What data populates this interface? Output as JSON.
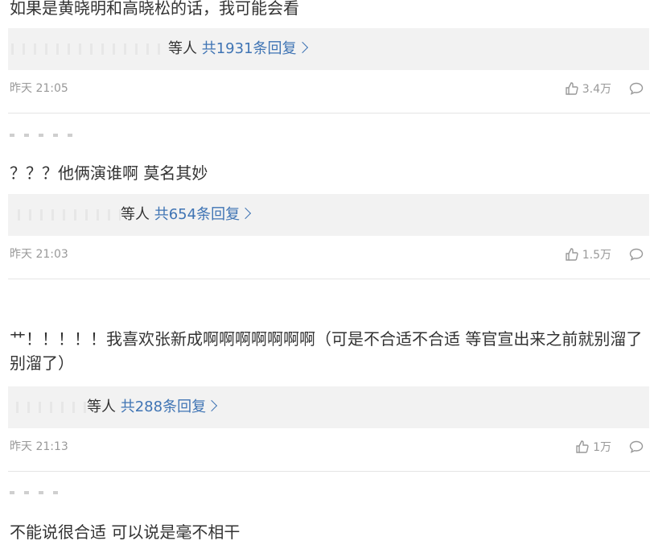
{
  "comments": [
    {
      "text": "如果是黄晓明和高晓松的话，我可能会看",
      "reply_names_suffix": "等人",
      "reply_link": "共1931条回复",
      "time": "昨天 21:05",
      "likes": "3.4万"
    },
    {
      "text": "？？？他俩演谁啊 莫名其妙",
      "reply_names_suffix": "等人",
      "reply_link": "共654条回复",
      "time": "昨天 21:03",
      "likes": "1.5万"
    },
    {
      "text": "艹！！！！！我喜欢张新成啊啊啊啊啊啊啊（可是不合适不合适 等官宣出来之前就别溜了别溜了）",
      "reply_names_suffix": "等人",
      "reply_link": "共288条回复",
      "time": "昨天 21:13",
      "likes": "1万"
    },
    {
      "text": "不能说很合适 可以说是毫不相干"
    }
  ],
  "icons": {
    "like": "thumbs-up-icon",
    "reply": "speech-bubble-icon",
    "chevron": "chevron-right-icon"
  },
  "colors": {
    "link": "#3f74b4",
    "meta": "#999999",
    "reply_bg": "#f2f2f2"
  }
}
